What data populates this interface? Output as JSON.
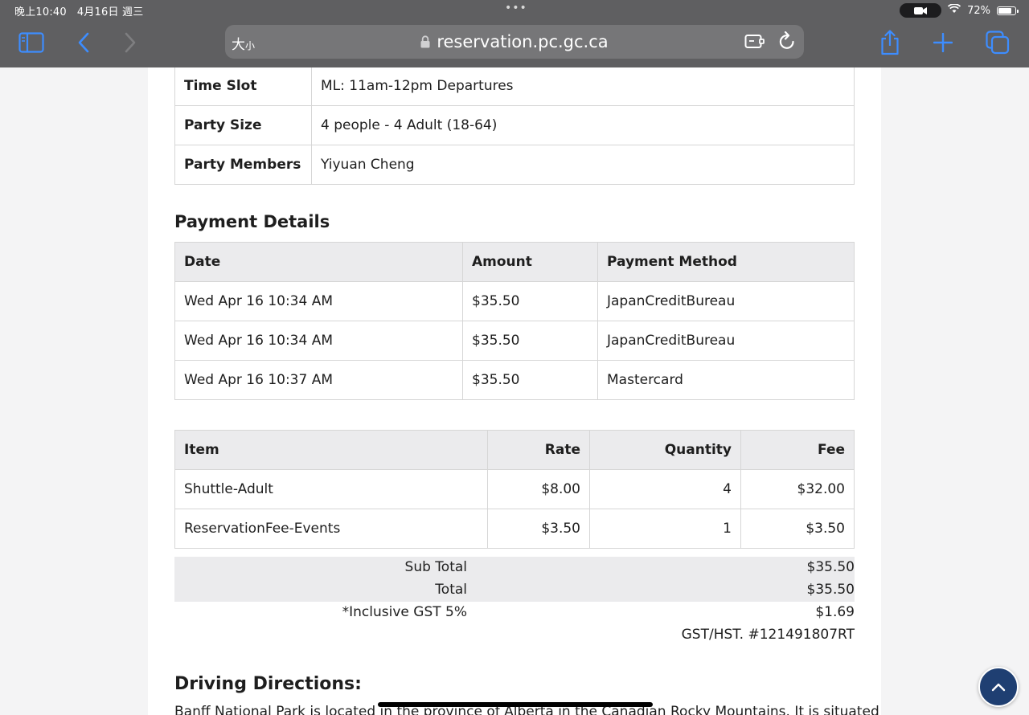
{
  "status_bar": {
    "time": "晚上10:40",
    "date": "4月16日 週三",
    "battery": "72%",
    "battery_level": 0.72
  },
  "address_bar": {
    "reader_label_big": "大",
    "reader_label_small": "小",
    "url": "reservation.pc.gc.ca"
  },
  "booking": {
    "rows": [
      {
        "label": "Time Slot",
        "value": "ML: 11am-12pm Departures"
      },
      {
        "label": "Party Size",
        "value": "4 people - 4 Adult (18-64)"
      },
      {
        "label": "Party Members",
        "value": "Yiyuan Cheng"
      }
    ]
  },
  "payment": {
    "heading": "Payment Details",
    "headers": {
      "date": "Date",
      "amount": "Amount",
      "method": "Payment Method"
    },
    "rows": [
      {
        "date": "Wed Apr 16 10:34 AM",
        "amount": "$35.50",
        "method": "JapanCreditBureau"
      },
      {
        "date": "Wed Apr 16 10:34 AM",
        "amount": "$35.50",
        "method": "JapanCreditBureau"
      },
      {
        "date": "Wed Apr 16 10:37 AM",
        "amount": "$35.50",
        "method": "Mastercard"
      }
    ]
  },
  "items": {
    "headers": {
      "item": "Item",
      "rate": "Rate",
      "quantity": "Quantity",
      "fee": "Fee"
    },
    "rows": [
      {
        "item": "Shuttle-Adult",
        "rate": "$8.00",
        "quantity": "4",
        "fee": "$32.00"
      },
      {
        "item": "ReservationFee-Events",
        "rate": "$3.50",
        "quantity": "1",
        "fee": "$3.50"
      }
    ]
  },
  "summary": {
    "subtotal_label": "Sub Total",
    "subtotal_value": "$35.50",
    "total_label": "Total",
    "total_value": "$35.50",
    "gst_label": "*Inclusive GST 5%",
    "gst_value": "$1.69",
    "gst_number": "GST/HST. #121491807RT"
  },
  "directions": {
    "heading": "Driving Directions:",
    "text": "Banff National Park is located in the province of Alberta in the Canadian Rocky Mountains. It is situated"
  }
}
